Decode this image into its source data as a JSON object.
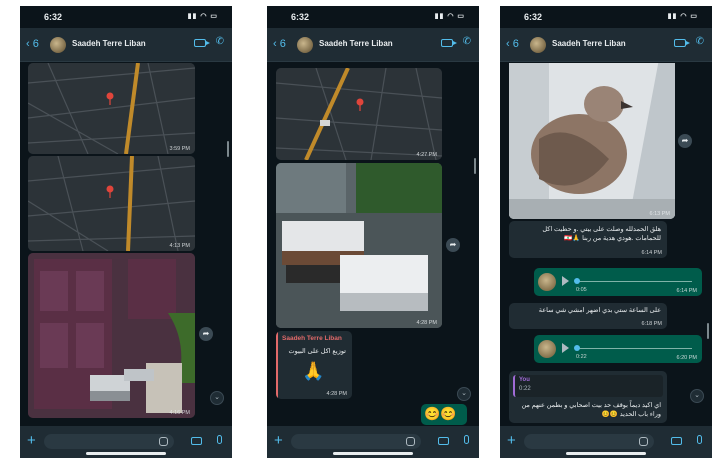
{
  "chat": {
    "contact_name": "Saadeh Terre Liban",
    "back_count": "6"
  },
  "phones": [
    {
      "status_time": "6:32",
      "messages": {
        "map1_time": "3:59 PM",
        "map2_time": "4:13 PM",
        "photo_time": "4:16 PM"
      }
    },
    {
      "status_time": "6:32",
      "messages": {
        "map_time": "4:27 PM",
        "photo_time": "4:28 PM",
        "card_sender": "Saadeh Terre Liban",
        "card_text": "توزيع اكل على البيوت",
        "card_emoji": "🙏",
        "card_time": "4:28 PM",
        "emoji_reply": "😊😊"
      }
    },
    {
      "status_time": "6:32",
      "messages": {
        "photo_time": "6:13 PM",
        "text1": "هلق الحمدلله وصلت على بيتي .و حطيت اكل للحمامات .هودي هدية من ربنا 🙏🇱🇧",
        "text1_time": "6:14 PM",
        "voice1_duration": "0:05",
        "voice1_time": "6:14 PM",
        "text2": "على الساعة ستي بدي اضهر امشي شي ساعة",
        "text2_time": "6:18 PM",
        "voice2_duration": "0:22",
        "voice2_time": "6:20 PM",
        "quote_author": "You",
        "quote_duration": "0:22",
        "reply_text": "اي اكيد ديماً بوقف حد بيت اصحابي و بطمن عنهم من وراء باب الحديد 😊😊"
      }
    }
  ],
  "icons": {
    "back": "chevron-left-icon",
    "video": "video-camera-icon",
    "phone": "phone-icon",
    "plus": "plus-icon",
    "sticker": "sticker-icon",
    "camera": "camera-icon",
    "mic": "microphone-icon",
    "forward": "forward-icon",
    "scroll_down": "chevron-down-icon"
  },
  "colors": {
    "background": "#0b141a",
    "header": "#1f2c34",
    "incoming": "#202c33",
    "outgoing": "#005c4b",
    "accent": "#53bdeb",
    "sender": "#e26a6a"
  }
}
